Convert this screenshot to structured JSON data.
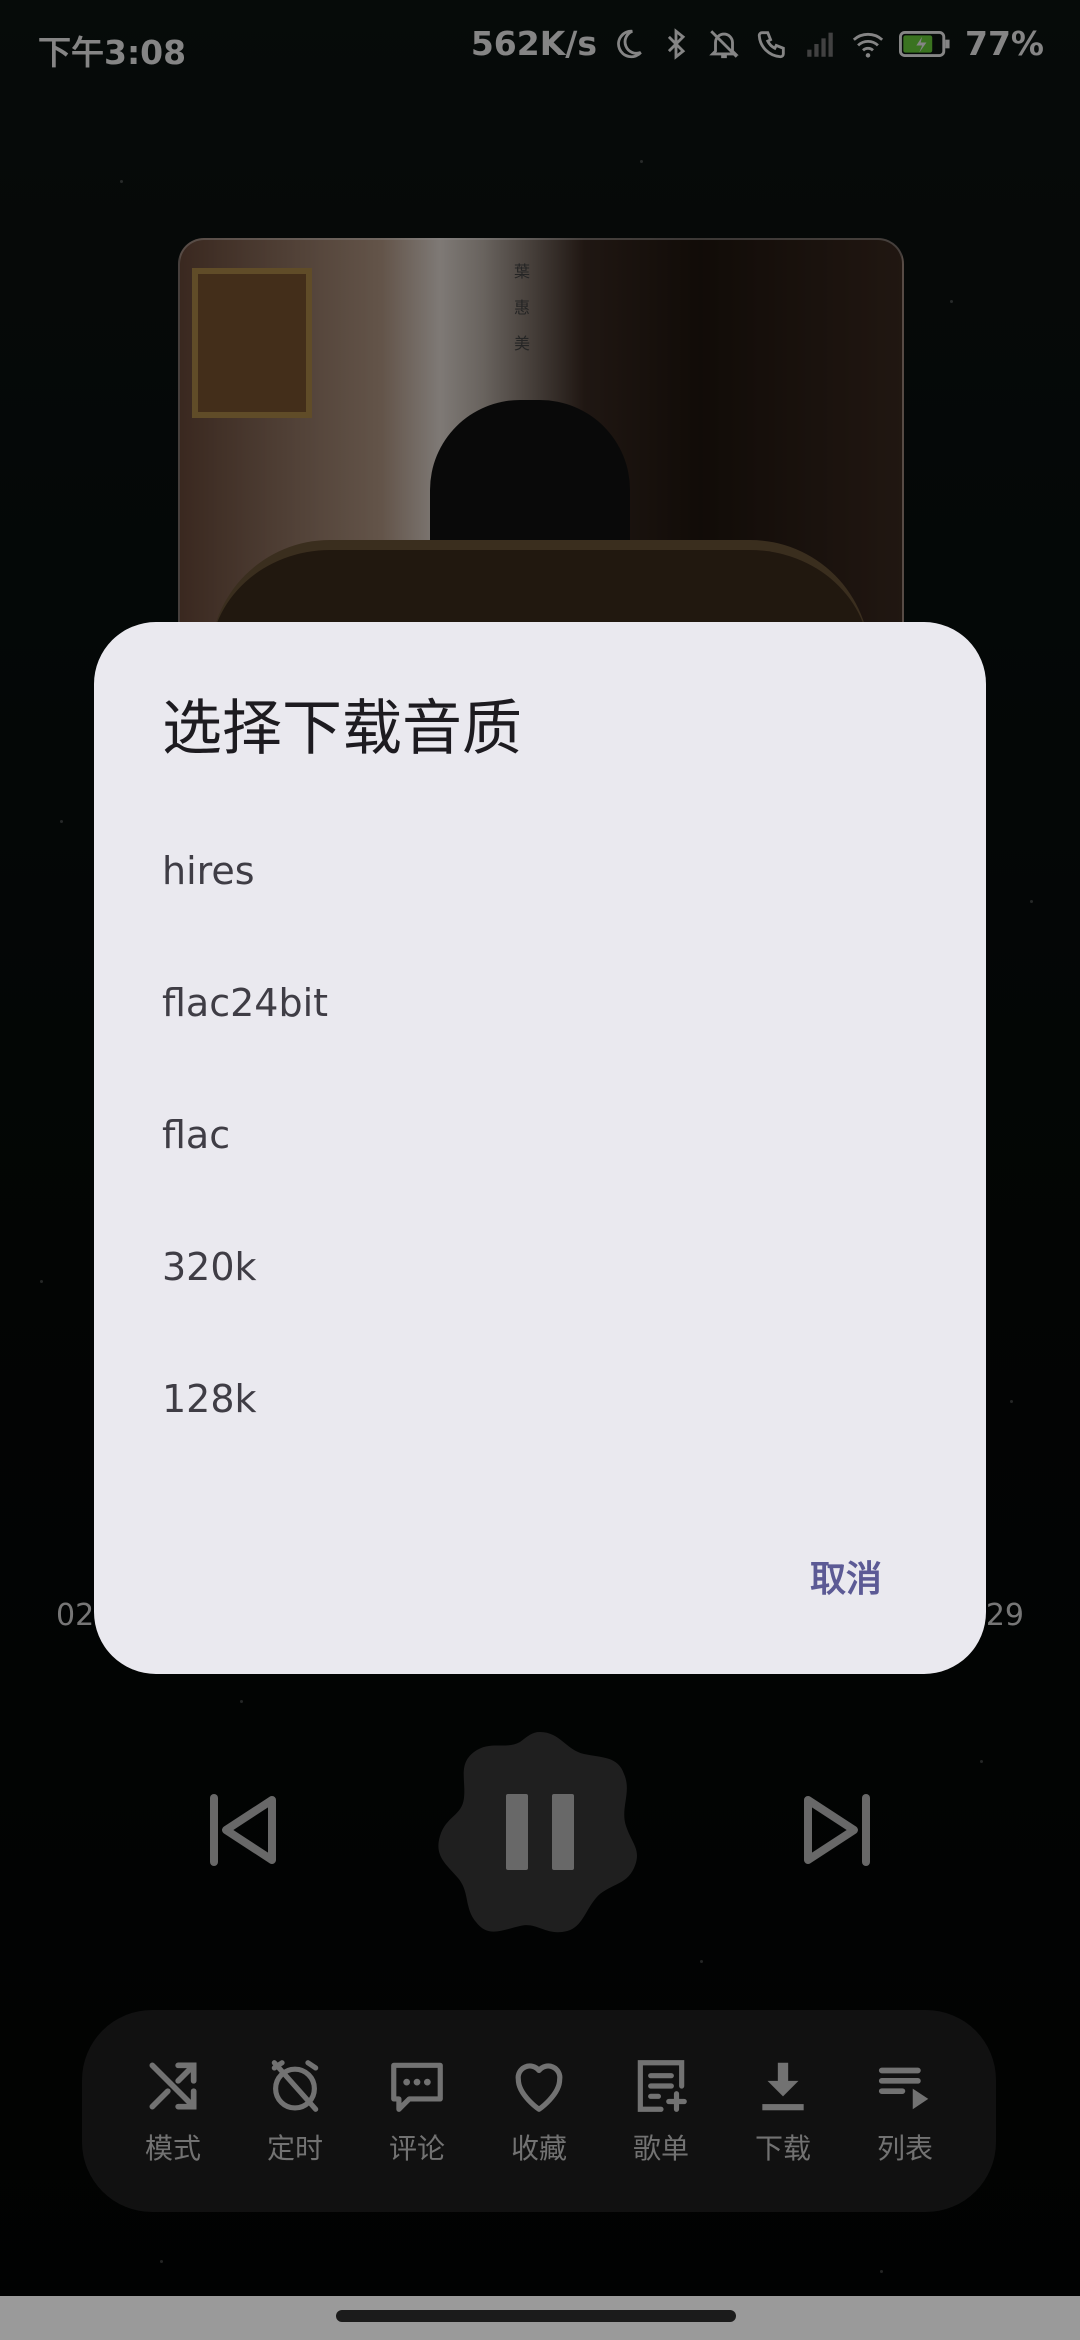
{
  "status_bar": {
    "time": "下午3:08",
    "net_speed": "562K/s",
    "battery": "77%",
    "icons": [
      "moon-icon",
      "bluetooth-icon",
      "bell-off-icon",
      "call-icon",
      "signal-icon",
      "wifi-icon",
      "battery-charging-icon"
    ]
  },
  "album": {
    "vertical_text": "葉惠美"
  },
  "player": {
    "elapsed": "02",
    "total": "29"
  },
  "dialog": {
    "title": "选择下载音质",
    "options": [
      "hires",
      "flac24bit",
      "flac",
      "320k",
      "128k"
    ],
    "cancel_label": "取消"
  },
  "toolbar": {
    "items": [
      {
        "label": "模式",
        "icon": "shuffle-icon"
      },
      {
        "label": "定时",
        "icon": "alarm-off-icon"
      },
      {
        "label": "评论",
        "icon": "comment-icon"
      },
      {
        "label": "收藏",
        "icon": "heart-icon"
      },
      {
        "label": "歌单",
        "icon": "playlist-add-icon"
      },
      {
        "label": "下载",
        "icon": "download-icon"
      },
      {
        "label": "列表",
        "icon": "queue-icon"
      }
    ]
  },
  "colors": {
    "dialog_bg": "#eae9ef",
    "accent": "#5c5a95",
    "toolbar_bg": "#1f1f1f"
  }
}
